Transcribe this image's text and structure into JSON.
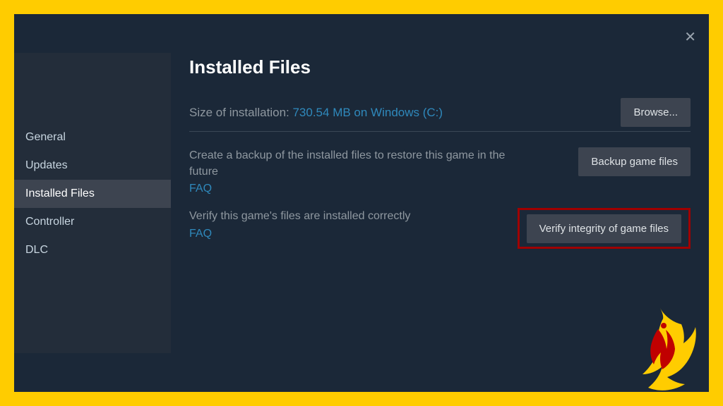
{
  "sidebar": {
    "items": [
      {
        "label": "General"
      },
      {
        "label": "Updates"
      },
      {
        "label": "Installed Files"
      },
      {
        "label": "Controller"
      },
      {
        "label": "DLC"
      }
    ]
  },
  "header": {
    "title": "Installed Files"
  },
  "install_size": {
    "label": "Size of installation: ",
    "value": "730.54 MB on Windows (C:)"
  },
  "buttons": {
    "browse": "Browse...",
    "backup": "Backup game files",
    "verify": "Verify integrity of game files"
  },
  "backup_section": {
    "text": "Create a backup of the installed files to restore this game in the future",
    "faq": "FAQ"
  },
  "verify_section": {
    "text": "Verify this game's files are installed correctly",
    "faq": "FAQ"
  },
  "close_glyph": "✕"
}
